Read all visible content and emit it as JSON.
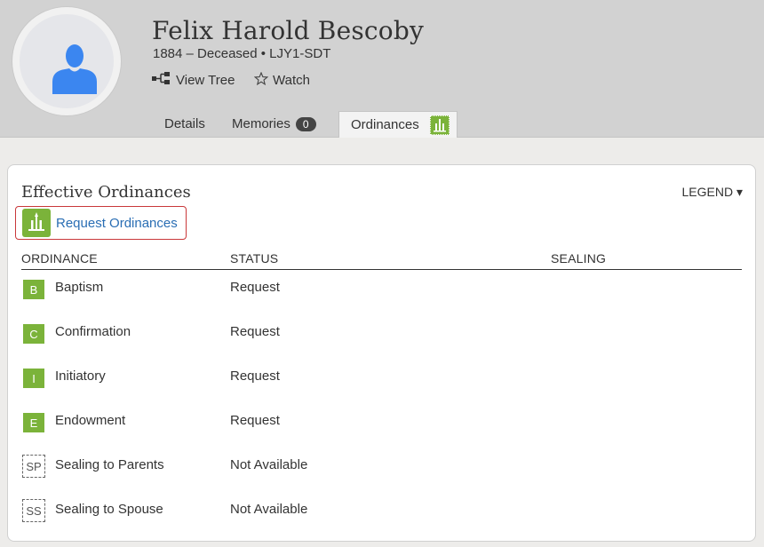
{
  "person": {
    "name": "Felix Harold Bescoby",
    "subtitle": "1884 – Deceased • LJY1-SDT"
  },
  "actions": {
    "view_tree": "View Tree",
    "watch": "Watch"
  },
  "tabs": [
    {
      "label": "Details"
    },
    {
      "label": "Memories",
      "badge": "0"
    },
    {
      "label": "Ordinances",
      "active": true
    }
  ],
  "card": {
    "title": "Effective Ordinances",
    "legend": "LEGEND ▾",
    "request_label": "Request Ordinances",
    "columns": [
      "ORDINANCE",
      "STATUS",
      "SEALING"
    ]
  },
  "ordinances": [
    {
      "code": "B",
      "name": "Baptism",
      "status": "Request",
      "style": "green"
    },
    {
      "code": "C",
      "name": "Confirmation",
      "status": "Request",
      "style": "green"
    },
    {
      "code": "I",
      "name": "Initiatory",
      "status": "Request",
      "style": "green"
    },
    {
      "code": "E",
      "name": "Endowment",
      "status": "Request",
      "style": "green"
    },
    {
      "code": "SP",
      "name": "Sealing to Parents",
      "status": "Not Available",
      "style": "dashed"
    },
    {
      "code": "SS",
      "name": "Sealing to Spouse",
      "status": "Not Available",
      "style": "dashed"
    }
  ],
  "colors": {
    "header_bg": "#d2d2d2",
    "temple_green": "#7bb33a",
    "link_blue": "#2a6eb4",
    "highlight_red": "#c9383a",
    "avatar_blue": "#3b86f0"
  },
  "icons": {
    "avatar": "person-silhouette-icon",
    "view_tree": "tree-icon",
    "watch": "star-outline-icon",
    "temple": "temple-icon"
  }
}
